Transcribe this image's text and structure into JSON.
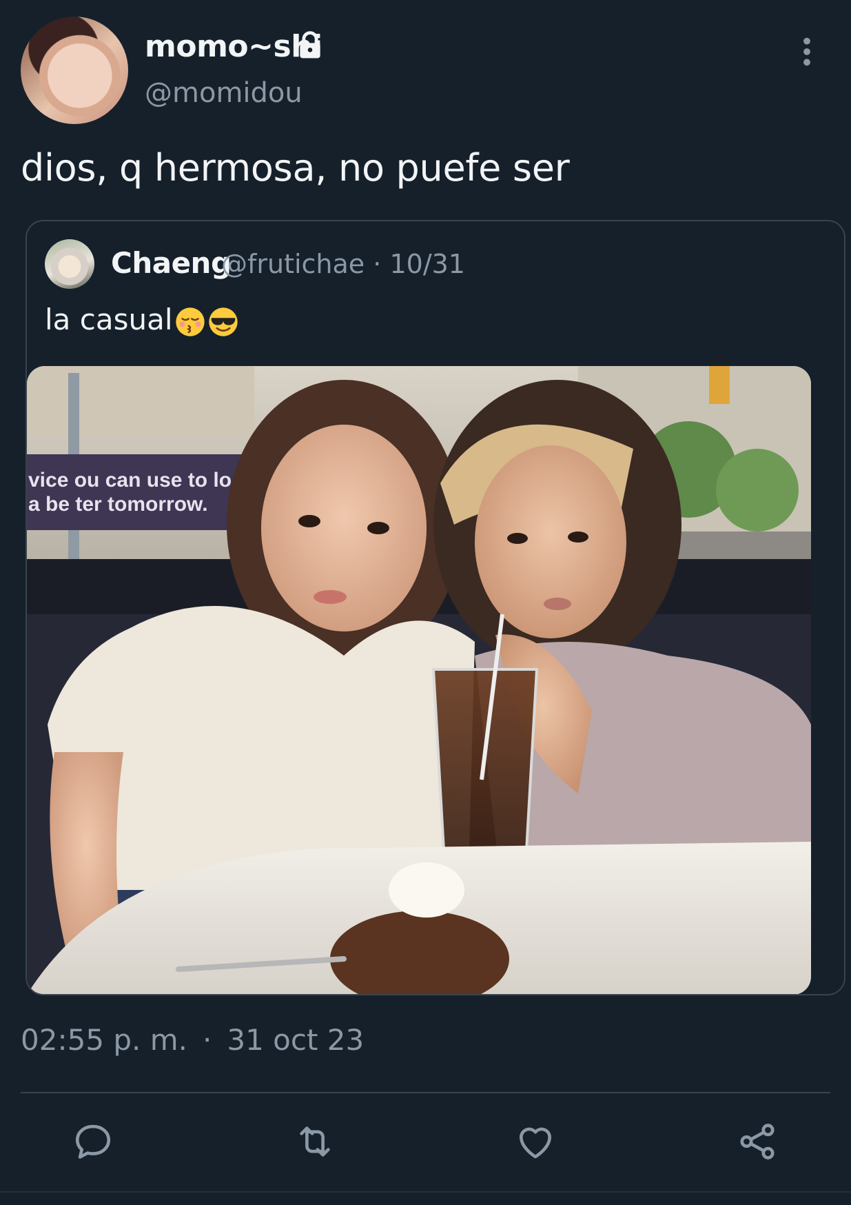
{
  "author": {
    "display_name": "momo~shi",
    "handle": "@momidou"
  },
  "tweet": {
    "text": "dios, q hermosa, no puefe ser",
    "time": "02:55 p. m.",
    "separator": "·",
    "date": "31 oct 23"
  },
  "quoted": {
    "display_name": "Chaeng",
    "handle": "@frutichae",
    "separator": "·",
    "date": "10/31",
    "text": "la casual",
    "emojis": [
      "kissing-face-closed-eyes",
      "smiling-face-with-sunglasses"
    ],
    "photo_sign_text": "vice ou can use to lo\na be ter tomorrow."
  },
  "actions": [
    "reply-icon",
    "retweet-icon",
    "like-icon",
    "share-icon"
  ],
  "colors": {
    "background": "#15202b",
    "text": "#e7e9ea",
    "secondary": "#8b98a5",
    "border": "#38444d"
  }
}
